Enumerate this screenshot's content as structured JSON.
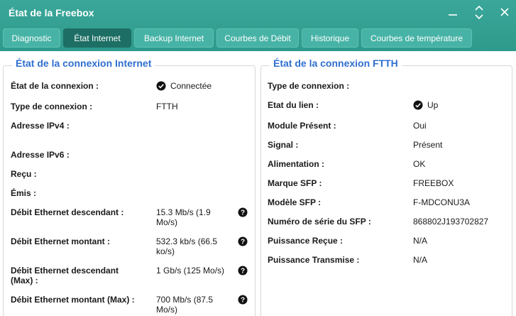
{
  "window": {
    "title": "État de la Freebox"
  },
  "tabs": [
    {
      "label": "Diagnostic"
    },
    {
      "label": "État Internet"
    },
    {
      "label": "Backup Internet"
    },
    {
      "label": "Courbes de Débit"
    },
    {
      "label": "Historique"
    },
    {
      "label": "Courbes de température"
    }
  ],
  "active_tab": "État Internet",
  "colors": {
    "accent": "#2e9a8c",
    "active_tab": "#1d6e64",
    "section_title": "#2f6fd0"
  },
  "internet": {
    "title": "État de la connexion Internet",
    "rows": [
      {
        "label": "État de la connexion :",
        "value": "Connectée"
      },
      {
        "label": "Type de connexion :",
        "value": "FTTH"
      },
      {
        "label": "Adresse IPv4 :",
        "value": ""
      },
      {
        "label": "Adresse IPv6 :",
        "value": ""
      },
      {
        "label": "Reçu :",
        "value": ""
      },
      {
        "label": "Émis :",
        "value": ""
      },
      {
        "label": "Débit Ethernet descendant :",
        "value_line1": "15.3 Mb/s (1.9",
        "value_line2": "Mo/s)"
      },
      {
        "label": "Débit Ethernet montant :",
        "value_line1": "532.3 kb/s (66.5",
        "value_line2": "ko/s)"
      },
      {
        "label_line1": "Débit Ethernet descendant",
        "label_line2": "(Max) :",
        "value": "1 Gb/s (125 Mo/s)"
      },
      {
        "label": "Débit Ethernet montant (Max) :",
        "value_line1": "700 Mb/s (87.5",
        "value_line2": "Mo/s)"
      }
    ]
  },
  "ftth": {
    "title": "État de la connexion FTTH",
    "rows": [
      {
        "label": "Type de connexion :",
        "value": ""
      },
      {
        "label": "Etat du lien :",
        "value": "Up"
      },
      {
        "label": "Module Présent :",
        "value": "Oui"
      },
      {
        "label": "Signal :",
        "value": "Présent"
      },
      {
        "label": "Alimentation :",
        "value": "OK"
      },
      {
        "label": "Marque SFP :",
        "value": "FREEBOX"
      },
      {
        "label": "Modèle SFP :",
        "value": "F-MDCONU3A"
      },
      {
        "label": "Numéro de série du SFP :",
        "value": "868802J193702827"
      },
      {
        "label": "Puissance Reçue :",
        "value": "N/A"
      },
      {
        "label": "Puissance Transmise :",
        "value": "N/A"
      }
    ]
  }
}
